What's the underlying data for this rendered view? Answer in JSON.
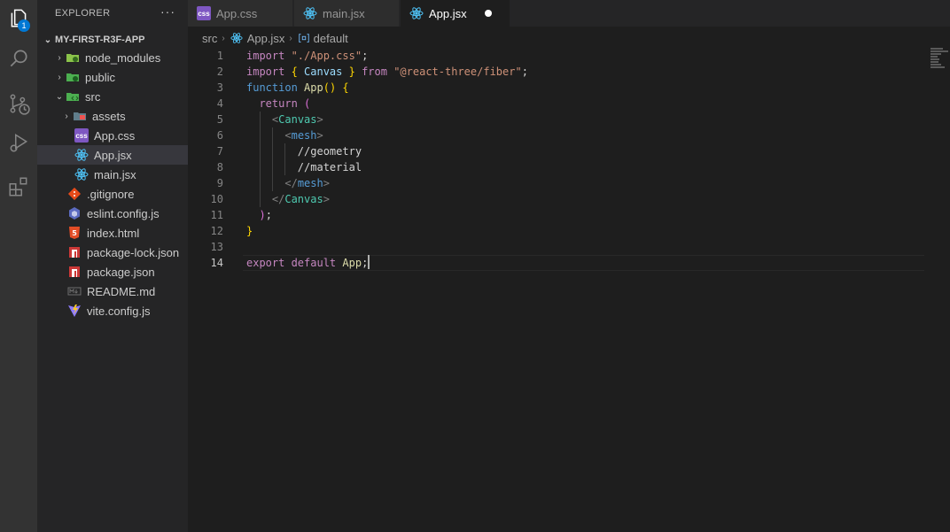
{
  "activity_bar": {
    "explorer_badge": "1",
    "icons": [
      "files-icon",
      "search-icon",
      "source-control-icon",
      "run-debug-icon",
      "extensions-icon"
    ]
  },
  "sidebar": {
    "header": "EXPLORER",
    "more_actions": "···",
    "project": "MY-FIRST-R3F-APP",
    "items": [
      {
        "label": "node_modules",
        "type": "folder",
        "icon": "node-modules-folder-icon"
      },
      {
        "label": "public",
        "type": "folder",
        "icon": "public-folder-icon"
      },
      {
        "label": "src",
        "type": "folder-open",
        "icon": "src-folder-icon"
      },
      {
        "label": "assets",
        "type": "folder",
        "icon": "assets-folder-icon"
      },
      {
        "label": "App.css",
        "type": "file",
        "icon": "css-file-icon"
      },
      {
        "label": "App.jsx",
        "type": "file",
        "icon": "react-file-icon"
      },
      {
        "label": "main.jsx",
        "type": "file",
        "icon": "react-file-icon"
      },
      {
        "label": ".gitignore",
        "type": "file",
        "icon": "git-file-icon"
      },
      {
        "label": "eslint.config.js",
        "type": "file",
        "icon": "eslint-file-icon"
      },
      {
        "label": "index.html",
        "type": "file",
        "icon": "html-file-icon"
      },
      {
        "label": "package-lock.json",
        "type": "file",
        "icon": "npm-file-icon"
      },
      {
        "label": "package.json",
        "type": "file",
        "icon": "npm-file-icon"
      },
      {
        "label": "README.md",
        "type": "file",
        "icon": "markdown-file-icon"
      },
      {
        "label": "vite.config.js",
        "type": "file",
        "icon": "vite-file-icon"
      }
    ],
    "selected": "App.jsx"
  },
  "tabs": [
    {
      "label": "App.css",
      "icon": "css-file-icon",
      "active": false
    },
    {
      "label": "main.jsx",
      "icon": "react-file-icon",
      "active": false
    },
    {
      "label": "App.jsx",
      "icon": "react-file-icon",
      "active": true,
      "dirty": true
    }
  ],
  "breadcrumb": {
    "folder": "src",
    "file": "App.jsx",
    "symbol": "default"
  },
  "editor": {
    "active_line": 14,
    "line_numbers": [
      "1",
      "2",
      "3",
      "4",
      "5",
      "6",
      "7",
      "8",
      "9",
      "10",
      "11",
      "12",
      "13",
      "14"
    ],
    "lines": [
      [
        {
          "t": "import ",
          "c": "kw"
        },
        {
          "t": "\"./App.css\"",
          "c": "str"
        },
        {
          "t": ";",
          "c": ""
        }
      ],
      [
        {
          "t": "import ",
          "c": "kw"
        },
        {
          "t": "{ ",
          "c": "br1"
        },
        {
          "t": "Canvas",
          "c": "var"
        },
        {
          "t": " }",
          "c": "br1"
        },
        {
          "t": " from ",
          "c": "kw"
        },
        {
          "t": "\"@react-three/fiber\"",
          "c": "str"
        },
        {
          "t": ";",
          "c": ""
        }
      ],
      [
        {
          "t": "function ",
          "c": "tagb"
        },
        {
          "t": "App",
          "c": "fn"
        },
        {
          "t": "() {",
          "c": "br1"
        }
      ],
      [
        {
          "t": "  return ",
          "c": "kw"
        },
        {
          "t": "(",
          "c": "br2"
        }
      ],
      [
        {
          "t": "    ",
          "c": ""
        },
        {
          "t": "<",
          "c": "punct"
        },
        {
          "t": "Canvas",
          "c": "tag"
        },
        {
          "t": ">",
          "c": "punct"
        }
      ],
      [
        {
          "t": "      ",
          "c": ""
        },
        {
          "t": "<",
          "c": "punct"
        },
        {
          "t": "mesh",
          "c": "tagb"
        },
        {
          "t": ">",
          "c": "punct"
        }
      ],
      [
        {
          "t": "        //geometry",
          "c": "cmt"
        }
      ],
      [
        {
          "t": "        //material",
          "c": "cmt"
        }
      ],
      [
        {
          "t": "      ",
          "c": ""
        },
        {
          "t": "</",
          "c": "punct"
        },
        {
          "t": "mesh",
          "c": "tagb"
        },
        {
          "t": ">",
          "c": "punct"
        }
      ],
      [
        {
          "t": "    ",
          "c": ""
        },
        {
          "t": "</",
          "c": "punct"
        },
        {
          "t": "Canvas",
          "c": "tag"
        },
        {
          "t": ">",
          "c": "punct"
        }
      ],
      [
        {
          "t": "  ",
          "c": ""
        },
        {
          "t": ")",
          "c": "br2"
        },
        {
          "t": ";",
          "c": ""
        }
      ],
      [
        {
          "t": "}",
          "c": "br1"
        }
      ],
      [],
      [
        {
          "t": "export ",
          "c": "kw"
        },
        {
          "t": "default ",
          "c": "kw"
        },
        {
          "t": "App",
          "c": "fn"
        },
        {
          "t": ";",
          "c": ""
        }
      ]
    ]
  },
  "colors": {
    "accent": "#0078d4",
    "editor_bg": "#1e1e1e",
    "sidebar_bg": "#252526",
    "activity_bg": "#333333"
  }
}
